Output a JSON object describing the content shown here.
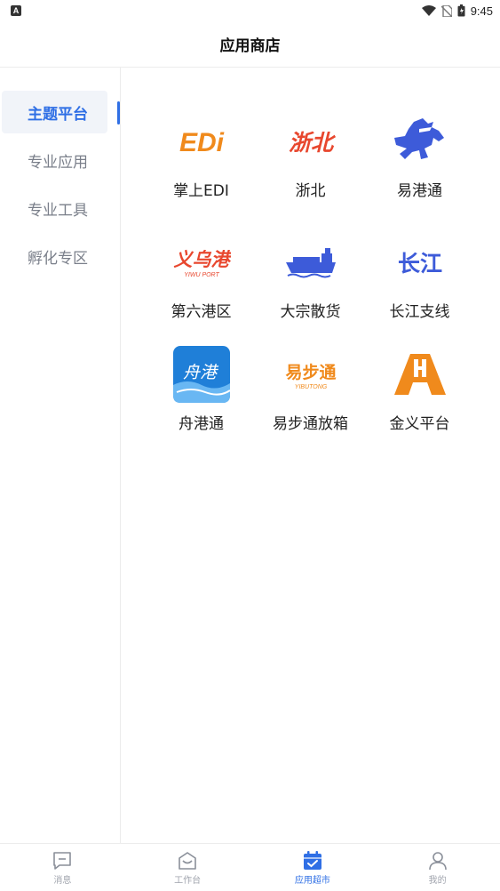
{
  "status_bar": {
    "time": "9:45",
    "badge": "A"
  },
  "header": {
    "title": "应用商店"
  },
  "sidebar": {
    "items": [
      {
        "label": "主题平台",
        "active": true
      },
      {
        "label": "专业应用",
        "active": false
      },
      {
        "label": "专业工具",
        "active": false
      },
      {
        "label": "孵化专区",
        "active": false
      }
    ]
  },
  "apps": [
    {
      "label": "掌上EDI",
      "icon": "edi-logo-icon",
      "logo_text": "EDi"
    },
    {
      "label": "浙北",
      "icon": "zhebei-logo-icon",
      "logo_text": "浙北"
    },
    {
      "label": "易港通",
      "icon": "yigangtong-horse-icon"
    },
    {
      "label": "第六港区",
      "icon": "yiwu-port-logo-icon",
      "logo_text": "义乌港",
      "logo_subtext": "YIWU PORT"
    },
    {
      "label": "大宗散货",
      "icon": "cargo-ship-icon"
    },
    {
      "label": "长江支线",
      "icon": "changjiang-logo-icon",
      "logo_text": "长江"
    },
    {
      "label": "舟港通",
      "icon": "zhougangtong-logo-icon",
      "logo_text": "舟港"
    },
    {
      "label": "易步通放箱",
      "icon": "yibutong-logo-icon",
      "logo_text": "易步通",
      "logo_subtext": "YIBUTONG"
    },
    {
      "label": "金义平台",
      "icon": "jinyi-logo-icon"
    }
  ],
  "bottom_nav": {
    "items": [
      {
        "label": "消息",
        "icon": "message-icon",
        "active": false
      },
      {
        "label": "工作台",
        "icon": "workbench-icon",
        "active": false
      },
      {
        "label": "应用超市",
        "icon": "app-market-icon",
        "active": true
      },
      {
        "label": "我的",
        "icon": "profile-icon",
        "active": false
      }
    ]
  },
  "colors": {
    "accent": "#2f6fe5",
    "orange": "#f08a1c",
    "red": "#e8472e",
    "blue_logo": "#3d5bd9"
  }
}
